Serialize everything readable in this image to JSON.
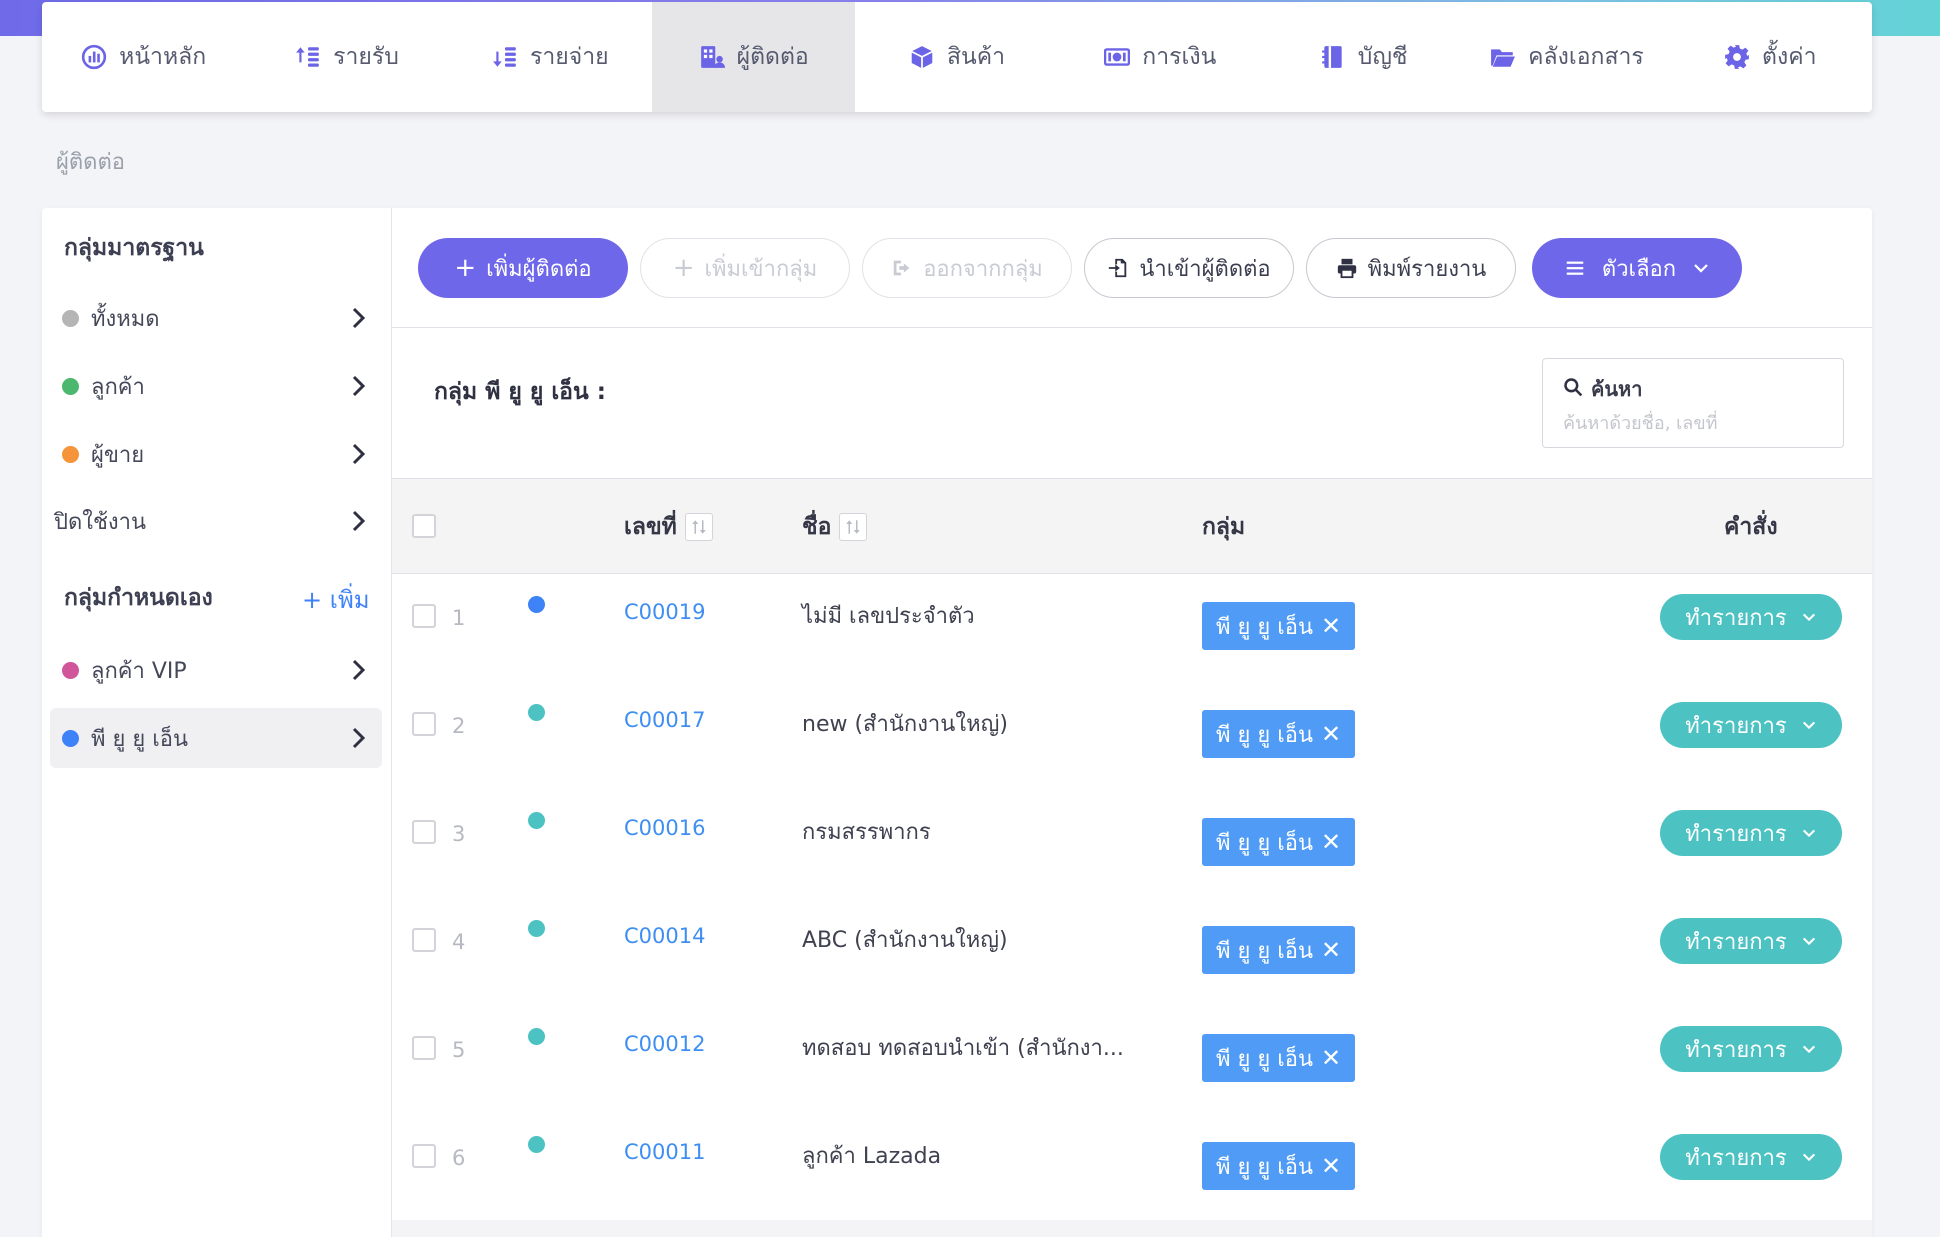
{
  "nav": {
    "items": [
      {
        "label": "หน้าหลัก",
        "icon": "dashboard-icon"
      },
      {
        "label": "รายรับ",
        "icon": "income-icon"
      },
      {
        "label": "รายจ่าย",
        "icon": "expense-icon"
      },
      {
        "label": "ผู้ติดต่อ",
        "icon": "contacts-icon",
        "active": true
      },
      {
        "label": "สินค้า",
        "icon": "box-icon"
      },
      {
        "label": "การเงิน",
        "icon": "money-icon"
      },
      {
        "label": "บัญชี",
        "icon": "book-icon"
      },
      {
        "label": "คลังเอกสาร",
        "icon": "folder-icon"
      },
      {
        "label": "ตั้งค่า",
        "icon": "gear-icon"
      }
    ]
  },
  "breadcrumb": "ผู้ติดต่อ",
  "sidebar": {
    "standard_title": "กลุ่มมาตรฐาน",
    "standard_items": [
      {
        "label": "ทั้งหมด",
        "dot_color": "#b5b5b5"
      },
      {
        "label": "ลูกค้า",
        "dot_color": "#4cb86f"
      },
      {
        "label": "ผู้ขาย",
        "dot_color": "#f5943a"
      },
      {
        "label": "ปิดใช้งาน",
        "dot_color": ""
      }
    ],
    "custom_title": "กลุ่มกำหนดเอง",
    "add_label": "+ เพิ่ม",
    "custom_items": [
      {
        "label": "ลูกค้า VIP",
        "dot_color": "#d0559a"
      },
      {
        "label": "พี ยู ยู เอ็น",
        "dot_color": "#3e82f7",
        "active": true
      }
    ]
  },
  "toolbar": {
    "add_contact": "เพิ่มผู้ติดต่อ",
    "add_to_group": "เพิ่มเข้ากลุ่ม",
    "remove_from_group": "ออกจากกลุ่ม",
    "import_contacts": "นำเข้าผู้ติดต่อ",
    "print_report": "พิมพ์รายงาน",
    "options": "ตัวเลือก"
  },
  "group_heading": "กลุ่ม พี ยู ยู เอ็น :",
  "search": {
    "label": "ค้นหา",
    "placeholder": "ค้นหาด้วยชื่อ, เลขที่",
    "value": ""
  },
  "table": {
    "headers": {
      "code": "เลขที่",
      "name": "ชื่อ",
      "group": "กลุ่ม",
      "action": "คำสั่ง"
    },
    "rows": [
      {
        "num": "1",
        "dot_color": "#3e82f7",
        "code": "C00019",
        "name": "ไม่มี เลขประจำตัว",
        "group": "พี ยู ยู เอ็น",
        "action": "ทำรายการ"
      },
      {
        "num": "2",
        "dot_color": "#4cc2c3",
        "code": "C00017",
        "name": "new (สำนักงานใหญ่)",
        "group": "พี ยู ยู เอ็น",
        "action": "ทำรายการ"
      },
      {
        "num": "3",
        "dot_color": "#4cc2c3",
        "code": "C00016",
        "name": "กรมสรรพากร",
        "group": "พี ยู ยู เอ็น",
        "action": "ทำรายการ"
      },
      {
        "num": "4",
        "dot_color": "#4cc2c3",
        "code": "C00014",
        "name": "ABC (สำนักงานใหญ่)",
        "group": "พี ยู ยู เอ็น",
        "action": "ทำรายการ"
      },
      {
        "num": "5",
        "dot_color": "#4cc2c3",
        "code": "C00012",
        "name": "ทดสอบ ทดสอบนำเข้า (สำนักงา...",
        "group": "พี ยู ยู เอ็น",
        "action": "ทำรายการ"
      },
      {
        "num": "6",
        "dot_color": "#4cc2c3",
        "code": "C00011",
        "name": "ลูกค้า Lazada",
        "group": "พี ยู ยู เอ็น",
        "action": "ทำรายการ"
      }
    ]
  },
  "colors": {
    "primary": "#6e67e9",
    "link": "#3e8ef3",
    "tag": "#4f9bf6",
    "action": "#4cc2c3"
  }
}
